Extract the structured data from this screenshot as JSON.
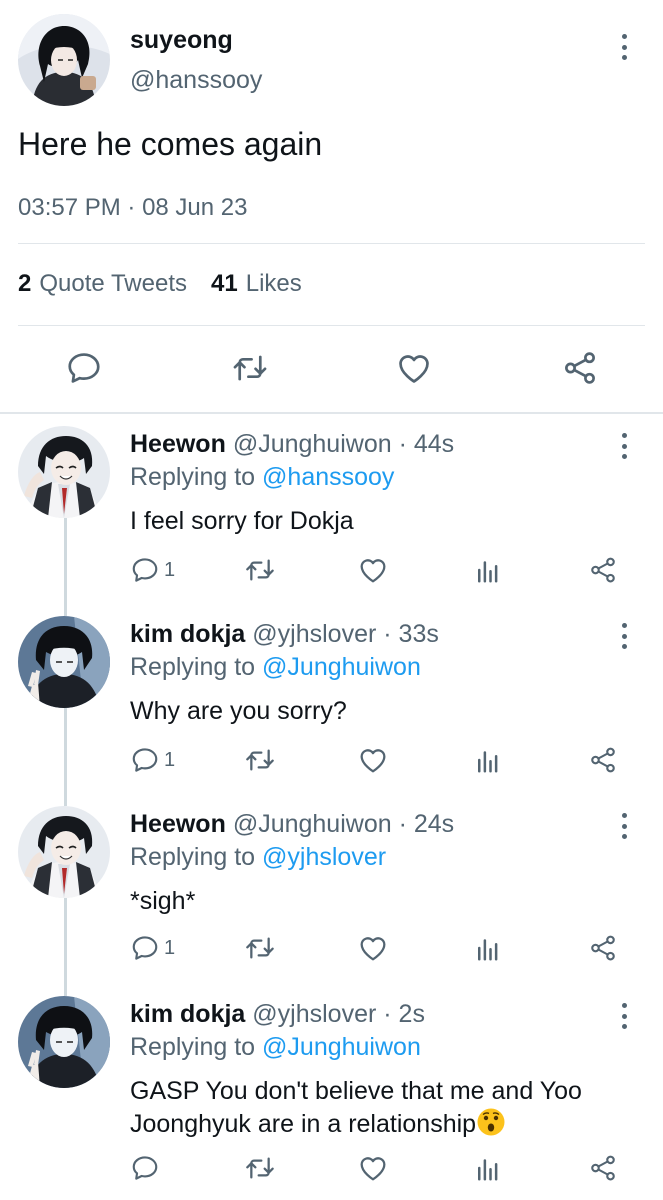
{
  "main_tweet": {
    "author_name": "suyeong",
    "author_handle": "@hanssooy",
    "text": "Here he comes again",
    "time": "03:57 PM",
    "separator": " · ",
    "date": "08 Jun 23",
    "quote_count": "2",
    "quote_label": "Quote Tweets",
    "like_count": "41",
    "like_label": "Likes"
  },
  "replies": [
    {
      "name": "Heewon",
      "handle": "@Junghuiwon",
      "time": "· 44s",
      "replying_label": "Replying to",
      "replying_to": "@hanssooy",
      "text": "I feel sorry for Dokja",
      "reply_count": "1"
    },
    {
      "name": "kim dokja",
      "handle": "@yjhslover",
      "time": "· 33s",
      "replying_label": "Replying to",
      "replying_to": "@Junghuiwon",
      "text": "Why are you sorry?",
      "reply_count": "1"
    },
    {
      "name": "Heewon",
      "handle": "@Junghuiwon",
      "time": "· 24s",
      "replying_label": "Replying to",
      "replying_to": "@yjhslover",
      "text": "*sigh*",
      "reply_count": "1"
    },
    {
      "name": "kim dokja",
      "handle": "@yjhslover",
      "time": "· 2s",
      "replying_label": "Replying to",
      "replying_to": "@Junghuiwon",
      "text": "GASP You don't believe that me and Yoo Joonghyuk are in a relationship",
      "reply_count": ""
    }
  ],
  "icons": {
    "reply": "reply-icon",
    "retweet": "retweet-icon",
    "like": "heart-icon",
    "share": "share-icon",
    "views": "views-icon",
    "more": "more-vertical-icon",
    "emoji": "astonished-face-emoji"
  },
  "colors": {
    "text_primary": "#0f1419",
    "text_secondary": "#536471",
    "accent": "#1d9bf0",
    "divider": "#e1e6ea",
    "thread_line": "#cfd9de"
  }
}
